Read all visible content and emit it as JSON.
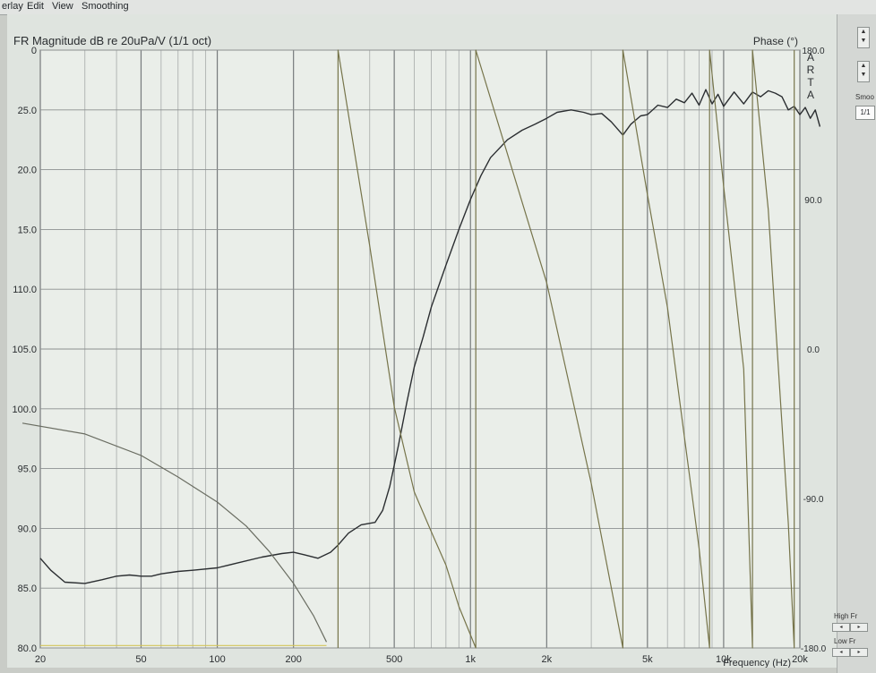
{
  "menu": [
    "erlay",
    "Edit",
    "View",
    "Smoothing"
  ],
  "chart_data": {
    "type": "line",
    "title": "FR Magnitude dB re 20uPa/V (1/1 oct)",
    "right_axis_title": "Phase (°)",
    "watermark": "ARTA",
    "xlabel": "Frequency (Hz)",
    "x_scale": "log",
    "xlim": [
      20,
      20000
    ],
    "x_tick_values": [
      20,
      50,
      100,
      200,
      500,
      1000,
      2000,
      5000,
      10000,
      20000
    ],
    "x_tick_labels": [
      "20",
      "50",
      "100",
      "200",
      "500",
      "1k",
      "2k",
      "5k",
      "10k",
      "20k"
    ],
    "ylim": [
      80,
      130
    ],
    "y_tick_values": [
      80,
      85,
      90,
      95,
      100,
      105,
      110,
      115,
      120,
      125,
      130
    ],
    "y_tick_labels": [
      "80.0",
      "85.0",
      "90.0",
      "95.0",
      "100.0",
      "105.0",
      "110.0",
      "15.0",
      "20.0",
      "25.0",
      "0"
    ],
    "y2lim": [
      -180,
      180
    ],
    "y2_tick_values": [
      180,
      90,
      0,
      -90,
      -180
    ],
    "y2_tick_labels": [
      "180.0",
      "90.0",
      "0.0",
      "-90.0",
      "-180.0"
    ],
    "grid": true,
    "series": [
      {
        "axis": "left",
        "color": "#2b2e31",
        "points": [
          [
            20,
            87.5
          ],
          [
            22,
            86.5
          ],
          [
            25,
            85.5
          ],
          [
            30,
            85.4
          ],
          [
            35,
            85.7
          ],
          [
            40,
            86
          ],
          [
            45,
            86.1
          ],
          [
            50,
            86
          ],
          [
            55,
            86
          ],
          [
            60,
            86.2
          ],
          [
            70,
            86.4
          ],
          [
            80,
            86.5
          ],
          [
            100,
            86.7
          ],
          [
            120,
            87.1
          ],
          [
            150,
            87.6
          ],
          [
            180,
            87.9
          ],
          [
            200,
            88
          ],
          [
            220,
            87.8
          ],
          [
            250,
            87.5
          ],
          [
            280,
            88
          ],
          [
            300,
            88.6
          ],
          [
            330,
            89.6
          ],
          [
            370,
            90.3
          ],
          [
            420,
            90.5
          ],
          [
            450,
            91.5
          ],
          [
            480,
            93.5
          ],
          [
            520,
            97
          ],
          [
            560,
            100.5
          ],
          [
            600,
            103.5
          ],
          [
            650,
            106
          ],
          [
            700,
            108.5
          ],
          [
            800,
            112
          ],
          [
            900,
            115
          ],
          [
            1000,
            117.5
          ],
          [
            1100,
            119.5
          ],
          [
            1200,
            121
          ],
          [
            1400,
            122.5
          ],
          [
            1600,
            123.3
          ],
          [
            1800,
            123.8
          ],
          [
            2000,
            124.3
          ],
          [
            2200,
            124.8
          ],
          [
            2500,
            125
          ],
          [
            2800,
            124.8
          ],
          [
            3000,
            124.6
          ],
          [
            3300,
            124.7
          ],
          [
            3600,
            124
          ],
          [
            4000,
            122.9
          ],
          [
            4300,
            123.8
          ],
          [
            4700,
            124.5
          ],
          [
            5000,
            124.6
          ],
          [
            5500,
            125.4
          ],
          [
            6000,
            125.2
          ],
          [
            6500,
            125.9
          ],
          [
            7000,
            125.6
          ],
          [
            7500,
            126.4
          ],
          [
            8000,
            125.4
          ],
          [
            8500,
            126.7
          ],
          [
            9000,
            125.5
          ],
          [
            9500,
            126.3
          ],
          [
            10000,
            125.3
          ],
          [
            11000,
            126.5
          ],
          [
            12000,
            125.5
          ],
          [
            13000,
            126.5
          ],
          [
            14000,
            126.1
          ],
          [
            15000,
            126.6
          ],
          [
            16000,
            126.4
          ],
          [
            17000,
            126.1
          ],
          [
            18000,
            125
          ],
          [
            19000,
            125.3
          ],
          [
            20000,
            124.6
          ],
          [
            21000,
            125.2
          ],
          [
            22000,
            124.3
          ],
          [
            23000,
            125
          ],
          [
            24000,
            123.6
          ]
        ]
      },
      {
        "axis": "left",
        "color": "#6a6d62",
        "points": [
          [
            17,
            98.8
          ],
          [
            30,
            97.9
          ],
          [
            50,
            96.1
          ],
          [
            70,
            94.3
          ],
          [
            100,
            92.2
          ],
          [
            130,
            90.2
          ],
          [
            160,
            88.1
          ],
          [
            200,
            85.4
          ],
          [
            240,
            82.7
          ],
          [
            270,
            80.5
          ]
        ]
      },
      {
        "axis": "right",
        "color": "#76744a",
        "points": [
          [
            300,
            -180
          ],
          [
            300,
            180
          ],
          [
            400,
            62
          ],
          [
            500,
            -35
          ],
          [
            600,
            -86
          ],
          [
            700,
            -110
          ],
          [
            800,
            -130
          ],
          [
            900,
            -155
          ],
          [
            1050,
            -180
          ],
          [
            1050,
            180
          ],
          [
            2000,
            40
          ],
          [
            3000,
            -81
          ],
          [
            4000,
            -180
          ],
          [
            4000,
            180
          ],
          [
            5000,
            93
          ],
          [
            6000,
            25
          ],
          [
            7000,
            -53
          ],
          [
            8000,
            -120
          ],
          [
            8800,
            -180
          ],
          [
            8800,
            180
          ],
          [
            10000,
            98
          ],
          [
            12000,
            -12
          ],
          [
            13000,
            -180
          ],
          [
            13000,
            180
          ],
          [
            15000,
            84
          ],
          [
            18000,
            -105
          ],
          [
            19000,
            -180
          ],
          [
            19000,
            180
          ]
        ]
      },
      {
        "axis": "left",
        "color": "#d3c45a",
        "points": [
          [
            20,
            80.2
          ],
          [
            270,
            80.2
          ]
        ]
      }
    ]
  },
  "side_panel": {
    "smoothing_label": "Smoo",
    "smoothing_value": "1/1",
    "high_label": "High Fr",
    "low_label": "Low Fr",
    "spin_up": "▲",
    "spin_down": "▼",
    "nudge_left": "◂",
    "nudge_right": "▸"
  }
}
